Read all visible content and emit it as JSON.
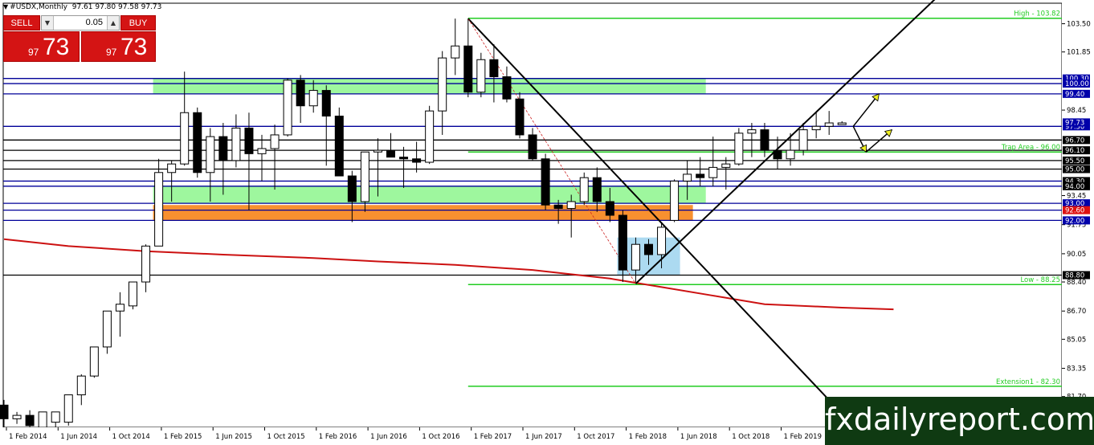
{
  "window": {
    "title": "#USDX,Monthly",
    "ohlc": "97.61 97.80 97.58 97.73"
  },
  "trade_panel": {
    "sell_label": "SELL",
    "buy_label": "BUY",
    "lot": "0.05",
    "sell_price_small": "97",
    "sell_price_big": "73",
    "buy_price_small": "97",
    "buy_price_big": "73"
  },
  "watermark": "fxdailyreport.com",
  "colors": {
    "up_candle": "#ffffff",
    "down_candle": "#000000",
    "green_line": "#22cc22",
    "blue_line": "#000099",
    "zone_green": "#99f799",
    "zone_orange": "#f88a24",
    "zone_blue": "#a8d8f0",
    "moving_average": "#cc1111",
    "arrow": "#f0f020",
    "watermark_bg": "#0f3a12"
  },
  "chart_data": {
    "type": "candlestick",
    "symbol": "#USDX",
    "timeframe": "Monthly",
    "y_range": [
      79.9,
      104.7
    ],
    "y_ticks": [
      "103.50",
      "101.85",
      "98.45",
      "93.45",
      "91.75",
      "90.05",
      "88.40",
      "86.70",
      "85.05",
      "83.35",
      "81.70"
    ],
    "x_labels": [
      "1 Feb 2014",
      "1 Jun 2014",
      "1 Oct 2014",
      "1 Feb 2015",
      "1 Jun 2015",
      "1 Oct 2015",
      "1 Feb 2016",
      "1 Jun 2016",
      "1 Oct 2016",
      "1 Feb 2017",
      "1 Jun 2017",
      "1 Oct 2017",
      "1 Feb 2018",
      "1 Jun 2018",
      "1 Oct 2018",
      "1 Feb 2019"
    ],
    "candles": [
      {
        "date": "2014-01",
        "o": 81.2,
        "h": 81.5,
        "l": 79.9,
        "c": 80.4
      },
      {
        "date": "2014-02",
        "o": 80.4,
        "h": 80.8,
        "l": 80.1,
        "c": 80.6
      },
      {
        "date": "2014-03",
        "o": 80.6,
        "h": 80.9,
        "l": 79.9,
        "c": 80.0
      },
      {
        "date": "2014-04",
        "o": 79.9,
        "h": 80.4,
        "l": 79.3,
        "c": 80.8
      },
      {
        "date": "2014-05",
        "o": 80.2,
        "h": 80.6,
        "l": 79.6,
        "c": 80.8
      },
      {
        "date": "2014-06",
        "o": 80.2,
        "h": 81.4,
        "l": 80.0,
        "c": 81.8
      },
      {
        "date": "2014-07",
        "o": 81.8,
        "h": 83.0,
        "l": 81.2,
        "c": 82.9
      },
      {
        "date": "2014-08",
        "o": 82.9,
        "h": 84.5,
        "l": 82.8,
        "c": 84.6
      },
      {
        "date": "2014-09",
        "o": 84.6,
        "h": 86.5,
        "l": 84.2,
        "c": 86.7
      },
      {
        "date": "2014-10",
        "o": 86.7,
        "h": 87.8,
        "l": 85.2,
        "c": 87.1
      },
      {
        "date": "2014-11",
        "o": 87.0,
        "h": 88.1,
        "l": 86.8,
        "c": 88.4
      },
      {
        "date": "2014-12",
        "o": 88.4,
        "h": 90.6,
        "l": 87.8,
        "c": 90.5
      },
      {
        "date": "2015-01",
        "o": 90.5,
        "h": 95.6,
        "l": 90.5,
        "c": 94.8
      },
      {
        "date": "2015-02",
        "o": 94.8,
        "h": 95.5,
        "l": 93.1,
        "c": 95.3
      },
      {
        "date": "2015-03",
        "o": 95.3,
        "h": 100.7,
        "l": 95.2,
        "c": 98.3
      },
      {
        "date": "2015-04",
        "o": 98.3,
        "h": 98.6,
        "l": 94.5,
        "c": 94.8
      },
      {
        "date": "2015-05",
        "o": 94.8,
        "h": 97.4,
        "l": 93.1,
        "c": 96.9
      },
      {
        "date": "2015-06",
        "o": 96.9,
        "h": 97.7,
        "l": 93.5,
        "c": 95.5
      },
      {
        "date": "2015-07",
        "o": 95.5,
        "h": 98.2,
        "l": 95.1,
        "c": 97.4
      },
      {
        "date": "2015-08",
        "o": 97.4,
        "h": 98.3,
        "l": 92.6,
        "c": 95.9
      },
      {
        "date": "2015-09",
        "o": 95.9,
        "h": 97.0,
        "l": 94.3,
        "c": 96.2
      },
      {
        "date": "2015-10",
        "o": 96.2,
        "h": 97.6,
        "l": 93.8,
        "c": 97.0
      },
      {
        "date": "2015-11",
        "o": 97.0,
        "h": 100.3,
        "l": 96.9,
        "c": 100.2
      },
      {
        "date": "2015-12",
        "o": 100.2,
        "h": 100.5,
        "l": 97.7,
        "c": 98.7
      },
      {
        "date": "2016-01",
        "o": 98.7,
        "h": 100.2,
        "l": 98.3,
        "c": 99.6
      },
      {
        "date": "2016-02",
        "o": 99.6,
        "h": 99.9,
        "l": 95.2,
        "c": 98.1
      },
      {
        "date": "2016-03",
        "o": 98.1,
        "h": 98.6,
        "l": 94.6,
        "c": 94.6
      },
      {
        "date": "2016-04",
        "o": 94.6,
        "h": 94.9,
        "l": 91.9,
        "c": 93.1
      },
      {
        "date": "2016-05",
        "o": 93.1,
        "h": 96.0,
        "l": 92.5,
        "c": 96.0
      },
      {
        "date": "2016-06",
        "o": 96.0,
        "h": 96.8,
        "l": 93.4,
        "c": 96.1
      },
      {
        "date": "2016-07",
        "o": 96.1,
        "h": 97.1,
        "l": 95.9,
        "c": 95.7
      },
      {
        "date": "2016-08",
        "o": 95.7,
        "h": 96.3,
        "l": 93.9,
        "c": 95.6
      },
      {
        "date": "2016-09",
        "o": 95.6,
        "h": 96.6,
        "l": 94.8,
        "c": 95.4
      },
      {
        "date": "2016-10",
        "o": 95.4,
        "h": 98.7,
        "l": 95.3,
        "c": 98.4
      },
      {
        "date": "2016-11",
        "o": 98.4,
        "h": 101.9,
        "l": 97.0,
        "c": 101.5
      },
      {
        "date": "2016-12",
        "o": 101.5,
        "h": 103.8,
        "l": 100.5,
        "c": 102.2
      },
      {
        "date": "2017-01",
        "o": 102.2,
        "h": 103.8,
        "l": 99.2,
        "c": 99.5
      },
      {
        "date": "2017-02",
        "o": 99.5,
        "h": 101.8,
        "l": 99.2,
        "c": 101.4
      },
      {
        "date": "2017-03",
        "o": 101.4,
        "h": 102.3,
        "l": 98.9,
        "c": 100.4
      },
      {
        "date": "2017-04",
        "o": 100.4,
        "h": 101.0,
        "l": 98.9,
        "c": 99.1
      },
      {
        "date": "2017-05",
        "o": 99.1,
        "h": 99.5,
        "l": 96.8,
        "c": 97.0
      },
      {
        "date": "2017-06",
        "o": 97.0,
        "h": 97.4,
        "l": 95.5,
        "c": 95.6
      },
      {
        "date": "2017-07",
        "o": 95.6,
        "h": 95.9,
        "l": 92.6,
        "c": 92.9
      },
      {
        "date": "2017-08",
        "o": 92.9,
        "h": 93.2,
        "l": 91.8,
        "c": 92.7
      },
      {
        "date": "2017-09",
        "o": 92.7,
        "h": 93.5,
        "l": 91.0,
        "c": 93.1
      },
      {
        "date": "2017-10",
        "o": 93.1,
        "h": 94.8,
        "l": 92.9,
        "c": 94.5
      },
      {
        "date": "2017-11",
        "o": 94.5,
        "h": 95.1,
        "l": 92.5,
        "c": 93.1
      },
      {
        "date": "2017-12",
        "o": 93.1,
        "h": 93.9,
        "l": 91.9,
        "c": 92.3
      },
      {
        "date": "2018-01",
        "o": 92.3,
        "h": 92.6,
        "l": 88.4,
        "c": 89.1
      },
      {
        "date": "2018-02",
        "o": 89.1,
        "h": 91.0,
        "l": 88.4,
        "c": 90.6
      },
      {
        "date": "2018-03",
        "o": 90.6,
        "h": 90.9,
        "l": 89.4,
        "c": 90.0
      },
      {
        "date": "2018-04",
        "o": 90.0,
        "h": 91.9,
        "l": 89.2,
        "c": 91.6
      },
      {
        "date": "2018-05",
        "o": 92.0,
        "h": 94.4,
        "l": 91.9,
        "c": 94.3
      },
      {
        "date": "2018-06",
        "o": 94.3,
        "h": 95.5,
        "l": 93.2,
        "c": 94.7
      },
      {
        "date": "2018-07",
        "o": 94.7,
        "h": 95.7,
        "l": 94.0,
        "c": 94.5
      },
      {
        "date": "2018-08",
        "o": 94.5,
        "h": 96.9,
        "l": 94.0,
        "c": 95.1
      },
      {
        "date": "2018-09",
        "o": 95.1,
        "h": 95.7,
        "l": 93.8,
        "c": 95.3
      },
      {
        "date": "2018-10",
        "o": 95.3,
        "h": 97.4,
        "l": 95.2,
        "c": 97.1
      },
      {
        "date": "2018-11",
        "o": 97.1,
        "h": 97.7,
        "l": 95.7,
        "c": 97.3
      },
      {
        "date": "2018-12",
        "o": 97.3,
        "h": 97.7,
        "l": 95.7,
        "c": 96.1
      },
      {
        "date": "2019-01",
        "o": 96.1,
        "h": 96.9,
        "l": 95.0,
        "c": 95.6
      },
      {
        "date": "2019-02",
        "o": 95.6,
        "h": 97.1,
        "l": 95.2,
        "c": 96.1
      },
      {
        "date": "2019-03",
        "o": 96.1,
        "h": 97.7,
        "l": 95.8,
        "c": 97.3
      },
      {
        "date": "2019-04",
        "o": 97.3,
        "h": 98.3,
        "l": 96.8,
        "c": 97.5
      },
      {
        "date": "2019-05",
        "o": 97.5,
        "h": 98.4,
        "l": 97.0,
        "c": 97.7
      },
      {
        "date": "2019-06",
        "o": 97.6,
        "h": 97.8,
        "l": 97.6,
        "c": 97.7
      }
    ],
    "horizontal_levels": [
      {
        "value": 100.3,
        "label": "100.30",
        "color": "#000099",
        "tag": "#0000aa",
        "text": "#ffffff"
      },
      {
        "value": 100.0,
        "label": "100.00",
        "color": "#000099",
        "tag": "#0000aa",
        "text": "#ffffff"
      },
      {
        "value": 99.4,
        "label": "99.40",
        "color": "#000099",
        "tag": "#0000aa",
        "text": "#ffffff"
      },
      {
        "value": 97.5,
        "label": "97.50",
        "color": "#000099",
        "tag": "#0000aa",
        "text": "#ffffff"
      },
      {
        "value": 97.73,
        "label": "97.73",
        "color": "#999999",
        "tag": "#0000aa",
        "text": "#ffffff",
        "hidden_line": true
      },
      {
        "value": 96.7,
        "label": "96.70",
        "color": "#000000",
        "tag": "#000000",
        "text": "#ffffff"
      },
      {
        "value": 96.1,
        "label": "96.10",
        "color": "#000000",
        "tag": "#000000",
        "text": "#ffffff"
      },
      {
        "value": 95.5,
        "label": "95.50",
        "color": "#000000",
        "tag": "#000000",
        "text": "#ffffff"
      },
      {
        "value": 95.0,
        "label": "95.00",
        "color": "#000000",
        "tag": "#000000",
        "text": "#ffffff"
      },
      {
        "value": 94.3,
        "label": "94.30",
        "color": "#000099",
        "tag": "#000000",
        "text": "#ffffff"
      },
      {
        "value": 94.0,
        "label": "94.00",
        "color": "#000099",
        "tag": "#000000",
        "text": "#ffffff"
      },
      {
        "value": 93.0,
        "label": "93.00",
        "color": "#000099",
        "tag": "#0000aa",
        "text": "#ffffff"
      },
      {
        "value": 92.6,
        "label": "92.60",
        "color": "#000099",
        "tag": "#dd1111",
        "text": "#ffffff"
      },
      {
        "value": 92.0,
        "label": "92.00",
        "color": "#000099",
        "tag": "#0000aa",
        "text": "#ffffff"
      },
      {
        "value": 88.8,
        "label": "88.80",
        "color": "#000000",
        "tag": "#000000",
        "text": "#ffffff"
      }
    ],
    "fib_levels": [
      {
        "value": 103.82,
        "label": "High - 103.82"
      },
      {
        "value": 96.0,
        "label": "Trap Area - 96.00"
      },
      {
        "value": 88.25,
        "label": "Low - 88.25"
      },
      {
        "value": 82.3,
        "label": "Extension1 - 82.30"
      }
    ],
    "zones": [
      {
        "name": "upper-resistance-zone",
        "x0": "2015-01",
        "x1": "2018-07",
        "y0": 99.4,
        "y1": 100.3,
        "color": "#99f799"
      },
      {
        "name": "green-support-zone",
        "x0": "2015-01",
        "x1": "2018-07",
        "y0": 93.0,
        "y1": 94.0,
        "color": "#99f799"
      },
      {
        "name": "orange-support-zone",
        "x0": "2015-01",
        "x1": "2018-06",
        "y0": 92.0,
        "y1": 92.9,
        "color": "#f88a24"
      },
      {
        "name": "blue-accumulation-zone",
        "x0": "2018-01",
        "x1": "2018-05",
        "y0": 88.8,
        "y1": 91.0,
        "color": "#a8d8f0"
      }
    ],
    "trendlines": [
      {
        "name": "falling-trendline",
        "x0": "2017-01",
        "y0": 103.8,
        "x1": "2019-07",
        "y1": 79.9
      },
      {
        "name": "rising-trendline",
        "x0": "2018-02",
        "y0": 88.3,
        "x1": "2020-02",
        "y1": 105.5
      },
      {
        "name": "fib-guide-line",
        "x0": "2017-01",
        "y0": 103.8,
        "x1": "2018-02",
        "y1": 88.3
      }
    ],
    "moving_average": [
      {
        "date": "2014-01",
        "v": 90.9
      },
      {
        "date": "2014-06",
        "v": 90.5
      },
      {
        "date": "2014-12",
        "v": 90.2
      },
      {
        "date": "2015-06",
        "v": 90.0
      },
      {
        "date": "2016-01",
        "v": 89.8
      },
      {
        "date": "2016-06",
        "v": 89.6
      },
      {
        "date": "2016-12",
        "v": 89.4
      },
      {
        "date": "2017-06",
        "v": 89.1
      },
      {
        "date": "2017-12",
        "v": 88.6
      },
      {
        "date": "2018-04",
        "v": 88.1
      },
      {
        "date": "2018-08",
        "v": 87.6
      },
      {
        "date": "2018-12",
        "v": 87.1
      },
      {
        "date": "2019-06",
        "v": 86.9
      },
      {
        "date": "2019-10",
        "v": 86.8
      }
    ],
    "arrows": [
      {
        "x0": "2019-06",
        "y0": 97.5,
        "x1": "2019-08",
        "y1": 99.4
      },
      {
        "x0": "2019-06",
        "y0": 97.5,
        "x1": "2019-07",
        "y1": 96.0
      },
      {
        "x0": "2019-07",
        "y0": 96.0,
        "x1": "2019-09",
        "y1": 97.3
      }
    ]
  }
}
